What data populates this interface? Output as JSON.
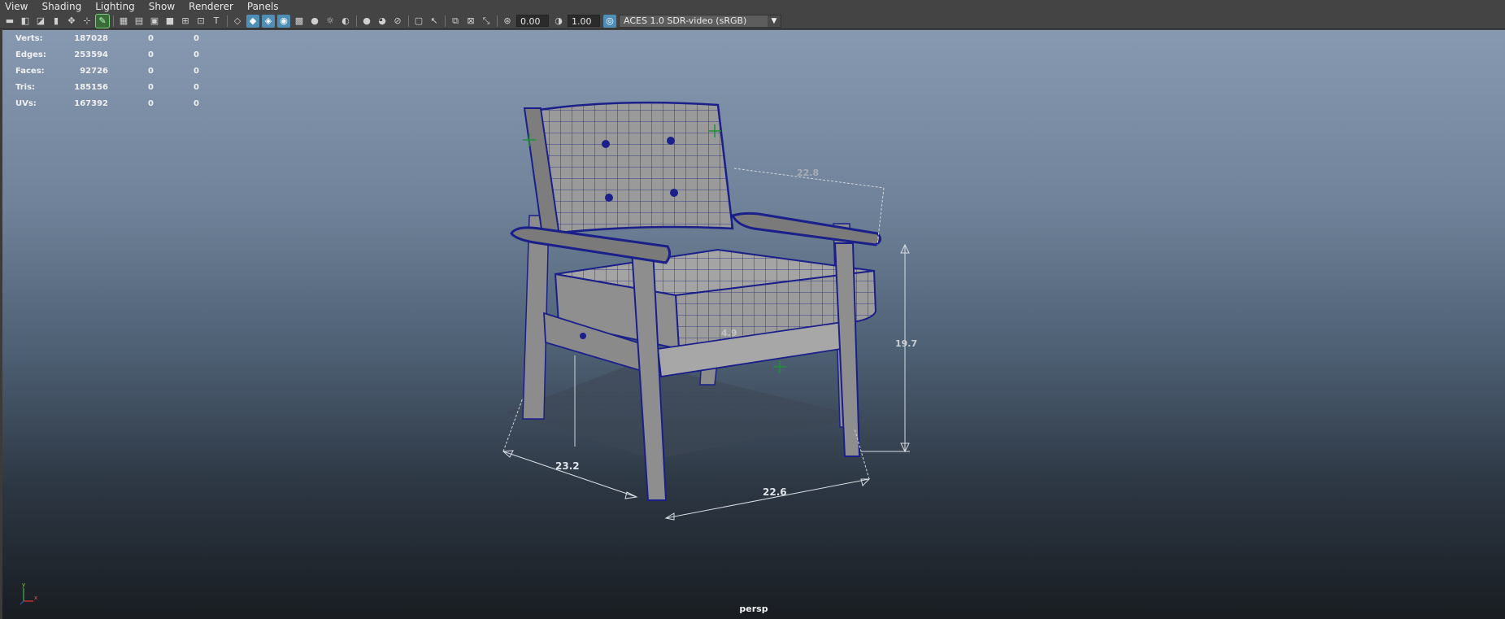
{
  "menu": [
    "View",
    "Shading",
    "Lighting",
    "Show",
    "Renderer",
    "Panels"
  ],
  "toolbar": {
    "icons": [
      "select-camera-icon",
      "camera-attributes-icon",
      "bookmark-icon",
      "image-plane-icon",
      "2d-pan-zoom-icon",
      "grease-pencil-icon",
      "grid-icon",
      "film-gate-icon",
      "resolution-gate-icon",
      "gate-mask-icon",
      "field-chart-icon",
      "safe-action-icon",
      "safe-title-icon",
      "wireframe-icon",
      "smooth-shade-icon",
      "wireframe-on-shaded-icon",
      "xray-icon",
      "textured-icon",
      "use-all-lights-icon",
      "shadows-icon",
      "screen-space-ao-icon",
      "motion-blur-icon",
      "anti-aliasing-icon",
      "depth-of-field-icon",
      "isolate-select-icon",
      "xray-joints-icon",
      "xray-active-components-icon",
      "exposure-icon",
      "gamma-icon",
      "color-management-icon"
    ],
    "exposure_value": "0.00",
    "gamma_value": "1.00",
    "color_space": "ACES 1.0 SDR-video (sRGB)"
  },
  "hud": {
    "rows": [
      {
        "label": "Verts:",
        "v1": "187028",
        "v2": "0",
        "v3": "0"
      },
      {
        "label": "Edges:",
        "v1": "253594",
        "v2": "0",
        "v3": "0"
      },
      {
        "label": "Faces:",
        "v1": "92726",
        "v2": "0",
        "v3": "0"
      },
      {
        "label": "Tris:",
        "v1": "185156",
        "v2": "0",
        "v3": "0"
      },
      {
        "label": "UVs:",
        "v1": "167392",
        "v2": "0",
        "v3": "0"
      }
    ]
  },
  "dimensions": {
    "width_left": "23.2",
    "width_front": "22.6",
    "height": "19.7",
    "back_depth": "22.8",
    "seat_thickness": "4.9"
  },
  "axis": {
    "y": "y",
    "x": "x"
  },
  "camera": "persp",
  "colors": {
    "wire": "#1a1f8a",
    "surface": "#9a9a9a",
    "viewport_top": "#8799b1",
    "viewport_bottom": "#191d22"
  }
}
